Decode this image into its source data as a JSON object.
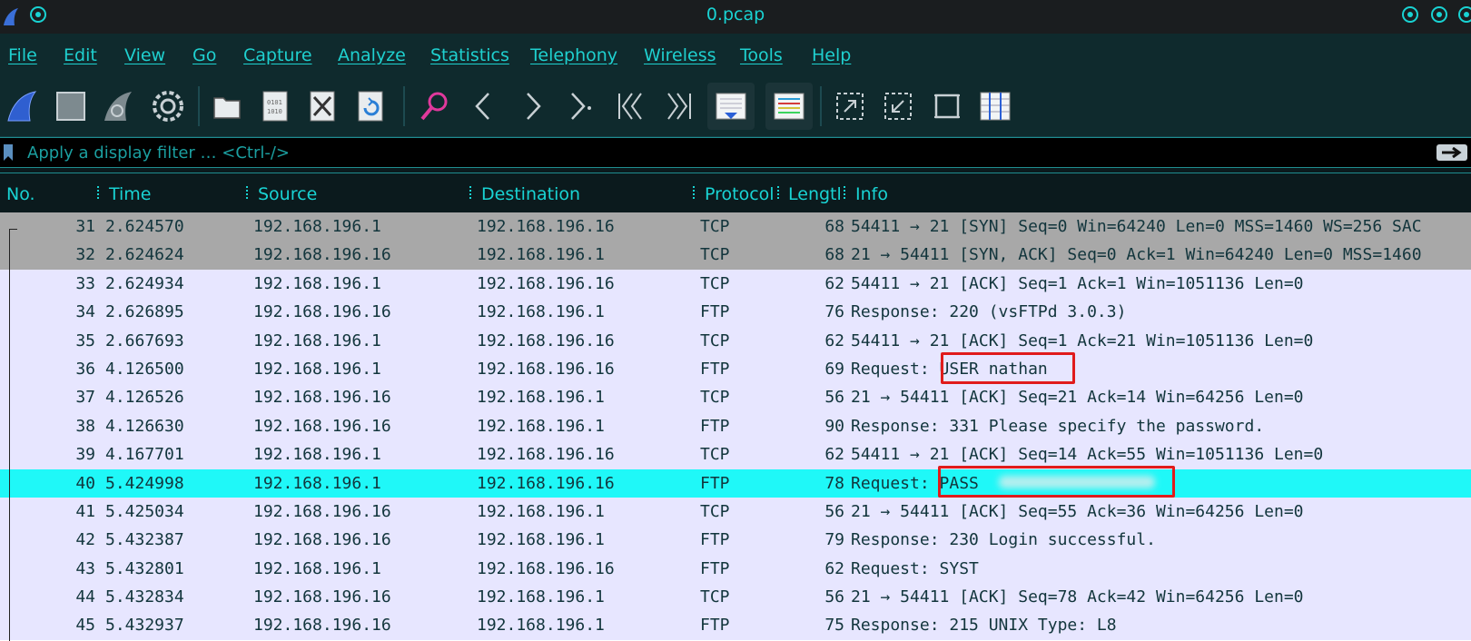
{
  "window": {
    "title": "0.pcap"
  },
  "menu": [
    "File",
    "Edit",
    "View",
    "Go",
    "Capture",
    "Analyze",
    "Statistics",
    "Telephony",
    "Wireless",
    "Tools",
    "Help"
  ],
  "toolbar": {
    "icons": [
      "shark-fin-start-icon",
      "stop-square-icon",
      "restart-fin-icon",
      "capture-options-gear-icon",
      "open-folder-icon",
      "save-file-icon",
      "close-file-icon",
      "reload-file-icon",
      "find-packet-icon",
      "go-back-icon",
      "go-forward-icon",
      "go-to-packet-icon",
      "first-packet-icon",
      "last-packet-icon",
      "autoscroll-icon",
      "colorize-icon",
      "zoom-in-icon",
      "zoom-out-icon",
      "normal-size-icon",
      "resize-columns-icon"
    ]
  },
  "filter": {
    "placeholder": "Apply a display filter … <Ctrl-/>"
  },
  "columns": {
    "no": "No.",
    "time": "Time",
    "source": "Source",
    "destination": "Destination",
    "protocol": "Protocol",
    "length": "Lengtl",
    "info": "Info"
  },
  "packets": [
    {
      "no": "31",
      "time": "2.624570",
      "src": "192.168.196.1",
      "dst": "192.168.196.16",
      "proto": "TCP",
      "len": "68",
      "info": "54411 → 21 [SYN] Seq=0 Win=64240 Len=0 MSS=1460 WS=256 SAC",
      "style": "syn"
    },
    {
      "no": "32",
      "time": "2.624624",
      "src": "192.168.196.16",
      "dst": "192.168.196.1",
      "proto": "TCP",
      "len": "68",
      "info": "21 → 54411 [SYN, ACK] Seq=0 Ack=1 Win=64240 Len=0 MSS=1460",
      "style": "syn"
    },
    {
      "no": "33",
      "time": "2.624934",
      "src": "192.168.196.1",
      "dst": "192.168.196.16",
      "proto": "TCP",
      "len": "62",
      "info": "54411 → 21 [ACK] Seq=1 Ack=1 Win=1051136 Len=0",
      "style": "tcp"
    },
    {
      "no": "34",
      "time": "2.626895",
      "src": "192.168.196.16",
      "dst": "192.168.196.1",
      "proto": "FTP",
      "len": "76",
      "info": "Response: 220 (vsFTPd 3.0.3)",
      "style": "ftp"
    },
    {
      "no": "35",
      "time": "2.667693",
      "src": "192.168.196.1",
      "dst": "192.168.196.16",
      "proto": "TCP",
      "len": "62",
      "info": "54411 → 21 [ACK] Seq=1 Ack=21 Win=1051136 Len=0",
      "style": "tcp"
    },
    {
      "no": "36",
      "time": "4.126500",
      "src": "192.168.196.1",
      "dst": "192.168.196.16",
      "proto": "FTP",
      "len": "69",
      "info": "Request: USER nathan",
      "style": "ftp"
    },
    {
      "no": "37",
      "time": "4.126526",
      "src": "192.168.196.16",
      "dst": "192.168.196.1",
      "proto": "TCP",
      "len": "56",
      "info": "21 → 54411 [ACK] Seq=21 Ack=14 Win=64256 Len=0",
      "style": "tcp"
    },
    {
      "no": "38",
      "time": "4.126630",
      "src": "192.168.196.16",
      "dst": "192.168.196.1",
      "proto": "FTP",
      "len": "90",
      "info": "Response: 331 Please specify the password.",
      "style": "ftp"
    },
    {
      "no": "39",
      "time": "4.167701",
      "src": "192.168.196.1",
      "dst": "192.168.196.16",
      "proto": "TCP",
      "len": "62",
      "info": "54411 → 21 [ACK] Seq=14 Ack=55 Win=1051136 Len=0",
      "style": "tcp"
    },
    {
      "no": "40",
      "time": "5.424998",
      "src": "192.168.196.1",
      "dst": "192.168.196.16",
      "proto": "FTP",
      "len": "78",
      "info": "Request: PASS",
      "style": "sel"
    },
    {
      "no": "41",
      "time": "5.425034",
      "src": "192.168.196.16",
      "dst": "192.168.196.1",
      "proto": "TCP",
      "len": "56",
      "info": "21 → 54411 [ACK] Seq=55 Ack=36 Win=64256 Len=0",
      "style": "tcp"
    },
    {
      "no": "42",
      "time": "5.432387",
      "src": "192.168.196.16",
      "dst": "192.168.196.1",
      "proto": "FTP",
      "len": "79",
      "info": "Response: 230 Login successful.",
      "style": "ftp"
    },
    {
      "no": "43",
      "time": "5.432801",
      "src": "192.168.196.1",
      "dst": "192.168.196.16",
      "proto": "FTP",
      "len": "62",
      "info": "Request: SYST",
      "style": "ftp"
    },
    {
      "no": "44",
      "time": "5.432834",
      "src": "192.168.196.16",
      "dst": "192.168.196.1",
      "proto": "TCP",
      "len": "56",
      "info": "21 → 54411 [ACK] Seq=78 Ack=42 Win=64256 Len=0",
      "style": "tcp"
    },
    {
      "no": "45",
      "time": "5.432937",
      "src": "192.168.196.16",
      "dst": "192.168.196.1",
      "proto": "FTP",
      "len": "75",
      "info": "Response: 215 UNIX Type: L8",
      "style": "ftp"
    }
  ],
  "colors": {
    "accent": "#19d3d3",
    "selected_row": "#1ff8f8",
    "syn_row": "#a8a8a8",
    "normal_row": "#e7e6ff",
    "highlight": "#e01b1b"
  }
}
